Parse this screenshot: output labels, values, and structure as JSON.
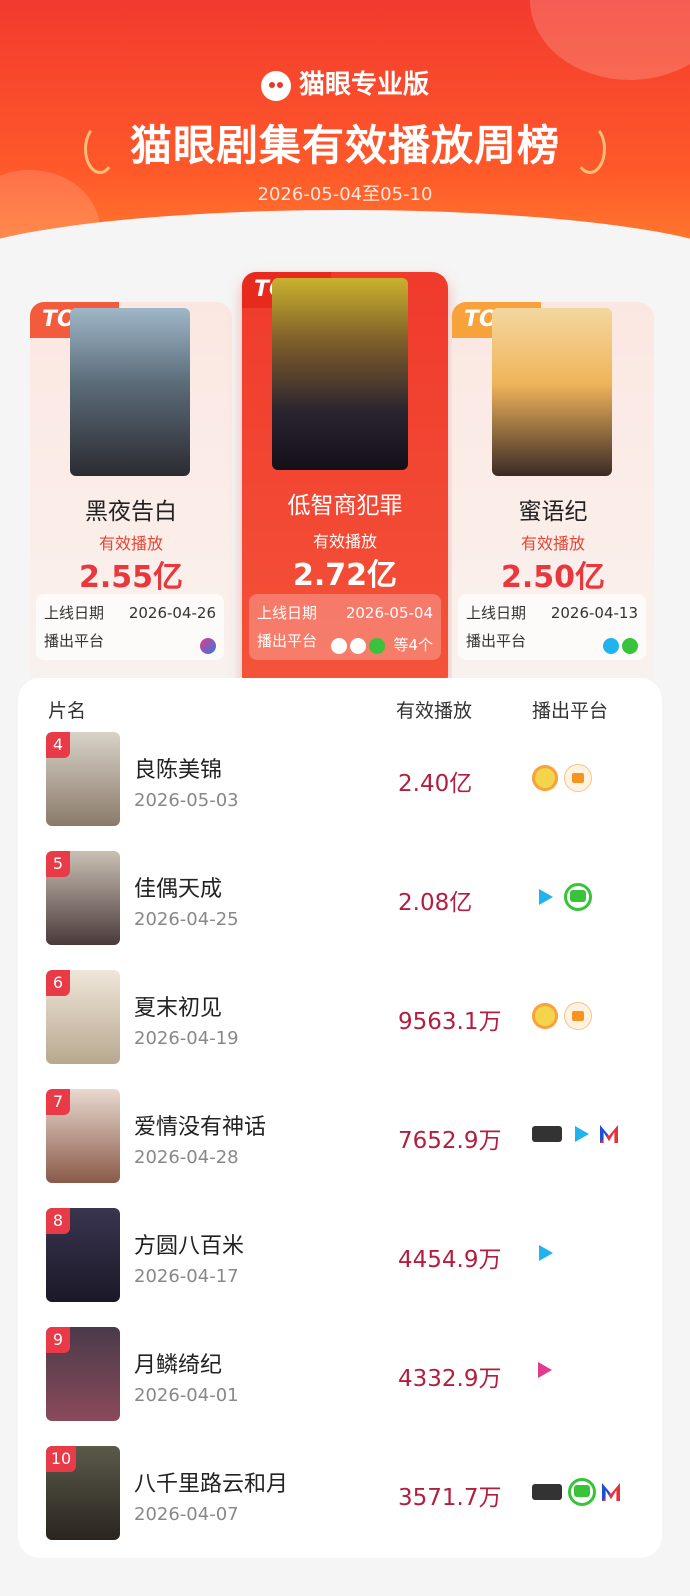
{
  "header": {
    "brand": "猫眼专业版",
    "title": "猫眼剧集有效播放周榜",
    "date_range": "2026-05-04至05-10"
  },
  "top3": [
    {
      "rank_label": "TOP1",
      "name": "低智商犯罪",
      "metric_label": "有效播放",
      "value": "2.72亿",
      "release_label": "上线日期",
      "release_date": "2026-05-04",
      "platform_label": "播出平台",
      "platform_extra": "等4个"
    },
    {
      "rank_label": "TOP2",
      "name": "黑夜告白",
      "metric_label": "有效播放",
      "value": "2.55亿",
      "release_label": "上线日期",
      "release_date": "2026-04-26",
      "platform_label": "播出平台"
    },
    {
      "rank_label": "TOP3",
      "name": "蜜语纪",
      "metric_label": "有效播放",
      "value": "2.50亿",
      "release_label": "上线日期",
      "release_date": "2026-04-13",
      "platform_label": "播出平台"
    }
  ],
  "list": {
    "headers": {
      "name": "片名",
      "metric": "有效播放",
      "platform": "播出平台"
    },
    "rows": [
      {
        "rank": "4",
        "name": "良陈美锦",
        "date": "2026-05-03",
        "value": "2.40亿",
        "platforms": [
          "youku-icon",
          "mgtv-icon"
        ]
      },
      {
        "rank": "5",
        "name": "佳偶天成",
        "date": "2026-04-25",
        "value": "2.08亿",
        "platforms": [
          "tencent-video-icon",
          "iqiyi-icon"
        ]
      },
      {
        "rank": "6",
        "name": "夏末初见",
        "date": "2026-04-19",
        "value": "9563.1万",
        "platforms": [
          "youku-icon",
          "mgtv-icon"
        ]
      },
      {
        "rank": "7",
        "name": "爱情没有神话",
        "date": "2026-04-28",
        "value": "7652.9万",
        "platforms": [
          "cctv-icon",
          "tencent-video-icon",
          "migu-icon"
        ]
      },
      {
        "rank": "8",
        "name": "方圆八百米",
        "date": "2026-04-17",
        "value": "4454.9万",
        "platforms": [
          "tencent-video-icon"
        ]
      },
      {
        "rank": "9",
        "name": "月鳞绮纪",
        "date": "2026-04-01",
        "value": "4332.9万",
        "platforms": [
          "youku-play-icon"
        ]
      },
      {
        "rank": "10",
        "name": "八千里路云和月",
        "date": "2026-04-07",
        "value": "3571.7万",
        "platforms": [
          "cctv-icon",
          "iqiyi-icon",
          "migu-icon"
        ]
      }
    ]
  },
  "colors": {
    "accent": "#e8383e",
    "header_red": "#f23a2e",
    "value_red": "#b31e3e"
  }
}
